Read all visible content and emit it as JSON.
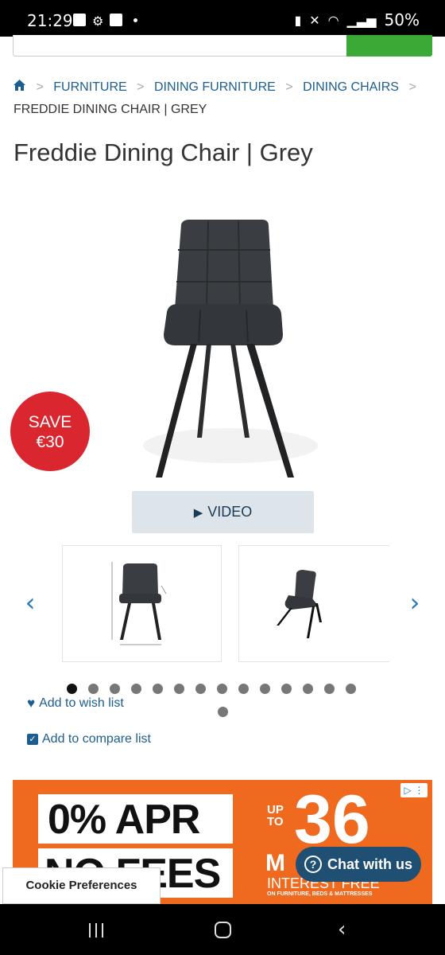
{
  "status_bar": {
    "time": "21:29",
    "battery": "50%",
    "icons": [
      "gallery-icon",
      "settings-icon",
      "check-icon",
      "dot-icon",
      "battery-saver-icon",
      "mute-icon",
      "wifi-icon",
      "signal-icon",
      "battery-icon"
    ]
  },
  "breadcrumb": {
    "items": [
      "FURNITURE",
      "DINING FURNITURE",
      "DINING CHAIRS"
    ],
    "current": "FREDDIE DINING CHAIR | GREY"
  },
  "product": {
    "title": "Freddie Dining Chair | Grey",
    "badge_line1": "SAVE",
    "badge_line2": "€30",
    "video_label": "VIDEO",
    "image_count": 15,
    "active_image": 0,
    "wish_label": "Add to wish list",
    "compare_label": "Add to compare list"
  },
  "ad": {
    "apr": "0% APR",
    "fees": "NO FEES",
    "up_to": "UP\nTO",
    "number": "36",
    "months": "M",
    "interest": "INTEREST FREE",
    "small": "ON FURNITURE, BEDS & MATTRESSES"
  },
  "chat": {
    "label": "Chat with us"
  },
  "cookie": {
    "label": "Cookie Preferences"
  },
  "colors": {
    "link": "#1b5e8f",
    "badge": "#d9262f",
    "ad": "#ef6a1f",
    "chat": "#1f4f73",
    "search_button": "#3aa935"
  }
}
